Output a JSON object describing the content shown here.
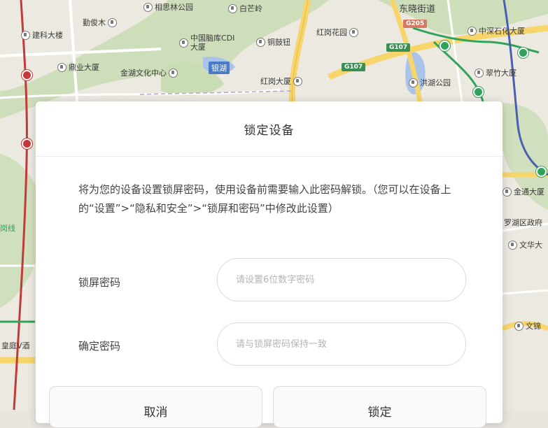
{
  "map": {
    "pois": [
      {
        "name": "相思林公园"
      },
      {
        "name": "白芒岭"
      },
      {
        "name": "东晓街道"
      },
      {
        "name": "勤俊木"
      },
      {
        "name": "建科大楼"
      },
      {
        "name": "中国脑库CDI大厦"
      },
      {
        "name": "铜鼓钮"
      },
      {
        "name": "红岗花园"
      },
      {
        "name": "中深石化大厦"
      },
      {
        "name": "鼎业大厦"
      },
      {
        "name": "金湖文化中心"
      },
      {
        "name": "翠竹大厦"
      },
      {
        "name": "红岗大厦"
      },
      {
        "name": "洪湖公园"
      },
      {
        "name": "金通大厦"
      },
      {
        "name": "罗湖区政府"
      },
      {
        "name": "文华大"
      },
      {
        "name": "文锦"
      },
      {
        "name": "皇庭V酒"
      }
    ],
    "lake_label": "银湖",
    "shields": [
      "G205",
      "G107",
      "G107"
    ],
    "line_label": "岗线",
    "colors": {
      "road": "#f7d56b",
      "park": "#c9dcb4",
      "water": "#a9c4e8",
      "base": "#ece9e1"
    }
  },
  "dialog": {
    "title": "锁定设备",
    "description": "将为您的设备设置锁屏密码，使用设备前需要输入此密码解锁。（您可以在设备上的“设置”>“隐私和安全”>“锁屏和密码”中修改此设置）",
    "lock_password": {
      "label": "锁屏密码",
      "placeholder": "请设置6位数字密码",
      "value": ""
    },
    "confirm_password": {
      "label": "确定密码",
      "placeholder": "请与锁屏密码保持一致",
      "value": ""
    },
    "cancel_label": "取消",
    "lock_label": "锁定"
  }
}
